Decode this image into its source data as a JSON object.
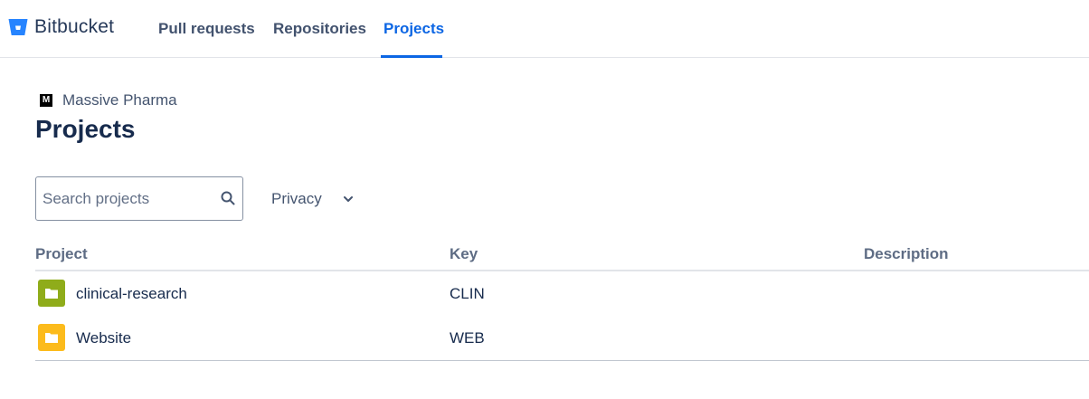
{
  "app": {
    "brand_name": "Bitbucket",
    "brand_color": "#2684ff"
  },
  "nav": {
    "items": [
      {
        "label": "Pull requests",
        "active": false
      },
      {
        "label": "Repositories",
        "active": false
      },
      {
        "label": "Projects",
        "active": true
      }
    ]
  },
  "workspace": {
    "avatar_letter": "M",
    "name": "Massive Pharma"
  },
  "page": {
    "title": "Projects"
  },
  "filters": {
    "search_placeholder": "Search projects",
    "search_value": "",
    "privacy_label": "Privacy"
  },
  "table": {
    "headers": {
      "project": "Project",
      "key": "Key",
      "description": "Description"
    },
    "rows": [
      {
        "name": "clinical-research",
        "key": "CLIN",
        "description": "",
        "icon": "folder-icon",
        "icon_color": "#8fac1a"
      },
      {
        "name": "Website",
        "key": "WEB",
        "description": "",
        "icon": "folder-icon",
        "icon_color": "#fcbb1c"
      }
    ]
  },
  "colors": {
    "accent": "#0c66e4",
    "text": "#172b4d",
    "muted": "#44546f"
  }
}
